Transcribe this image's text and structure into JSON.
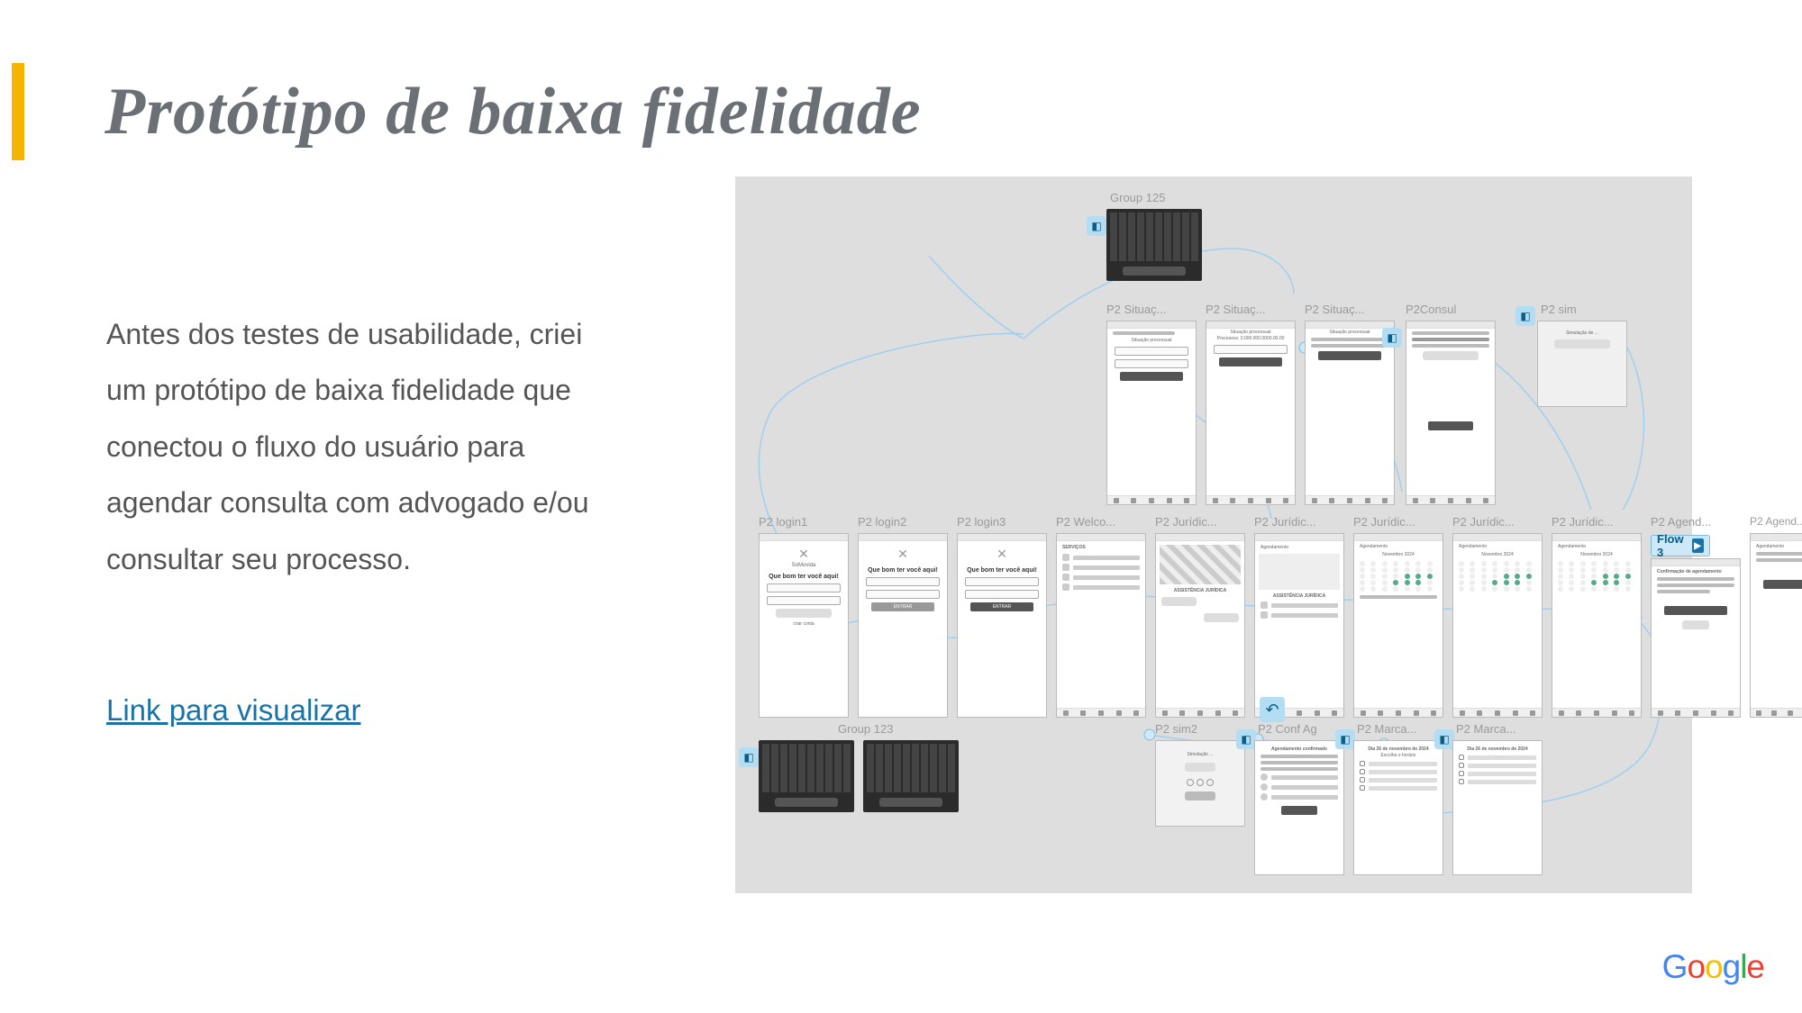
{
  "title": "Protótipo de baixa fidelidade",
  "body": "Antes dos testes de usabilidade, criei um protótipo de baixa fidelidade que conectou o fluxo do usuário para agendar consulta com advogado e/ou consultar seu processo.",
  "link_text": "Link para visualizar",
  "logo": "Google",
  "flow_badge": "Flow 3",
  "groups": {
    "g125": "Group 125",
    "g123": "Group 123"
  },
  "frames": {
    "row1": [
      {
        "label": "P2 Situaç...",
        "header": "Situação processual"
      },
      {
        "label": "P2 Situaç...",
        "header": "Situação processual"
      },
      {
        "label": "P2 Situaç...",
        "header": "Situação processual"
      },
      {
        "label": "P2Consul"
      },
      {
        "label": "P2 sim",
        "header": "Simulação de ..."
      }
    ],
    "row2": [
      {
        "label": "P2 login1",
        "title": "Que bom ter você aqui!"
      },
      {
        "label": "P2 login2",
        "title": "Que bom ter você aqui!"
      },
      {
        "label": "P2 login3",
        "title": "Que bom ter você aqui!"
      },
      {
        "label": "P2 Welco...",
        "header": "SERVIÇOS"
      },
      {
        "label": "P2 Jurídic..."
      },
      {
        "label": "P2 Jurídic...",
        "header": "Agendamento",
        "sub": "ASSISTÊNCIA JURÍDICA"
      },
      {
        "label": "P2 Jurídic...",
        "header": "Agendamento",
        "month": "Novembro 2024"
      },
      {
        "label": "P2 Jurídic...",
        "header": "Agendamento",
        "month": "Novembro 2024"
      },
      {
        "label": "P2 Jurídic...",
        "header": "Agendamento",
        "month": "Novembro 2024"
      },
      {
        "label": "P2 Agend...",
        "header": "Confirmação de agendamento"
      },
      {
        "label": "P2 Agend...",
        "header": "Agendamento"
      }
    ],
    "row3": [
      {
        "label": "P2 sim2",
        "header": "Simulação ..."
      },
      {
        "label": "P2 Conf Ag",
        "header": "Agendamento confirmado"
      },
      {
        "label": "P2 Marca...",
        "header": "Dia 26 de novembro de 2024"
      },
      {
        "label": "P2 Marca...",
        "header": "Dia 26 de novembro de 2024"
      }
    ]
  }
}
